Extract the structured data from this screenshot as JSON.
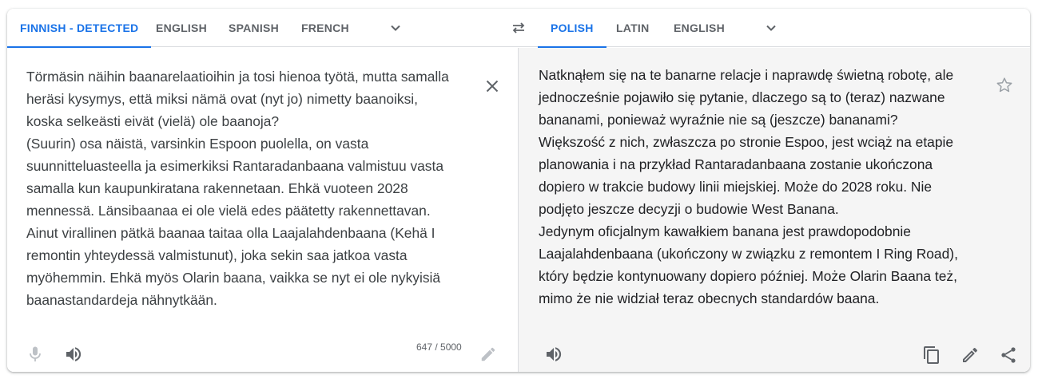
{
  "source_tabs": [
    {
      "label": "FINNISH - DETECTED",
      "active": true
    },
    {
      "label": "ENGLISH",
      "active": false
    },
    {
      "label": "SPANISH",
      "active": false
    },
    {
      "label": "FRENCH",
      "active": false
    }
  ],
  "target_tabs": [
    {
      "label": "POLISH",
      "active": true
    },
    {
      "label": "LATIN",
      "active": false
    },
    {
      "label": "ENGLISH",
      "active": false
    }
  ],
  "source": {
    "text": "Törmäsin näihin baanarelaatioihin ja tosi hienoa työtä, mutta samalla\nheräsi kysymys, että miksi nämä ovat (nyt jo) nimetty baanoiksi,\nkoska selkeästi eivät (vielä) ole baanoja?\n(Suurin) osa näistä, varsinkin Espoon puolella, on vasta\nsuunnitteluasteella ja esimerkiksi Rantaradanbaana valmistuu vasta\nsamalla kun kaupunkiratana rakennetaan. Ehkä vuoteen 2028\nmennessä. Länsibaanaa ei ole vielä edes päätetty rakennettavan.\nAinut virallinen pätkä baanaa taitaa olla Laajalahdenbaana (Kehä I\nremontin yhteydessä valmistunut), joka sekin saa jatkoa vasta\nmyöhemmin. Ehkä myös Olarin baana, vaikka se nyt ei ole nykyisiä\nbaanastandardeja nähnytkään.",
    "char_count": "647 / 5000"
  },
  "target": {
    "text": "Natknąłem się na te banarne relacje i naprawdę świetną robotę, ale\njednocześnie pojawiło się pytanie, dlaczego są to (teraz) nazwane\nbananami, ponieważ wyraźnie nie są (jeszcze) bananami?\nWiększość z nich, zwłaszcza po stronie Espoo, jest wciąż na etapie\nplanowania i na przykład Rantaradanbaana zostanie ukończona\ndopiero w trakcie budowy linii miejskiej. Może do 2028 roku. Nie\npodjęto jeszcze decyzji o budowie West Banana.\nJedynym oficjalnym kawałkiem banana jest prawdopodobnie\nLaajalahdenbaana (ukończony w związku z remontem I Ring Road),\nktóry będzie kontynuowany dopiero później. Może Olarin Baana też,\nmimo że nie widział teraz obecnych standardów baana."
  },
  "icons": {
    "source_more": "chevron-down-icon",
    "swap": "swap-languages-icon",
    "target_more": "chevron-down-icon",
    "clear": "close-icon",
    "mic": "microphone-icon",
    "listen_source": "speaker-icon",
    "edit_source": "pencil-icon",
    "star": "star-outline-icon",
    "listen_target": "speaker-icon",
    "copy": "copy-icon",
    "edit_target": "pencil-icon",
    "share": "share-icon"
  },
  "colors": {
    "accent": "#1a73e8",
    "tab_text": "#5f6368",
    "target_bg": "#f5f5f5",
    "divider": "#dadce0"
  }
}
